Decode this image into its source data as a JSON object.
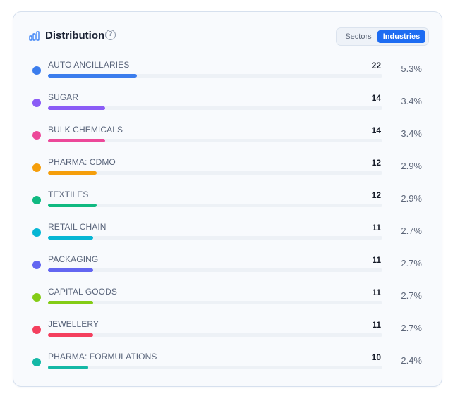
{
  "header": {
    "title": "Distribution",
    "help_glyph": "?",
    "toggle": {
      "options": [
        "Sectors",
        "Industries"
      ],
      "selected": "Industries"
    }
  },
  "colors": {
    "accent": "#1d6cf2"
  },
  "items": [
    {
      "label": "AUTO ANCILLARIES",
      "count": "22",
      "pct": "5.3%",
      "share": 0.053,
      "color": "#3b7ded"
    },
    {
      "label": "SUGAR",
      "count": "14",
      "pct": "3.4%",
      "share": 0.034,
      "color": "#8b5cf6"
    },
    {
      "label": "BULK CHEMICALS",
      "count": "14",
      "pct": "3.4%",
      "share": 0.034,
      "color": "#ec4899"
    },
    {
      "label": "PHARMA: CDMO",
      "count": "12",
      "pct": "2.9%",
      "share": 0.029,
      "color": "#f59e0b"
    },
    {
      "label": "TEXTILES",
      "count": "12",
      "pct": "2.9%",
      "share": 0.029,
      "color": "#10b981"
    },
    {
      "label": "RETAIL CHAIN",
      "count": "11",
      "pct": "2.7%",
      "share": 0.027,
      "color": "#06b6d4"
    },
    {
      "label": "PACKAGING",
      "count": "11",
      "pct": "2.7%",
      "share": 0.027,
      "color": "#6366f1"
    },
    {
      "label": "CAPITAL GOODS",
      "count": "11",
      "pct": "2.7%",
      "share": 0.027,
      "color": "#84cc16"
    },
    {
      "label": "JEWELLERY",
      "count": "11",
      "pct": "2.7%",
      "share": 0.027,
      "color": "#f43f5e"
    },
    {
      "label": "PHARMA: FORMULATIONS",
      "count": "10",
      "pct": "2.4%",
      "share": 0.024,
      "color": "#14b8a6"
    }
  ]
}
